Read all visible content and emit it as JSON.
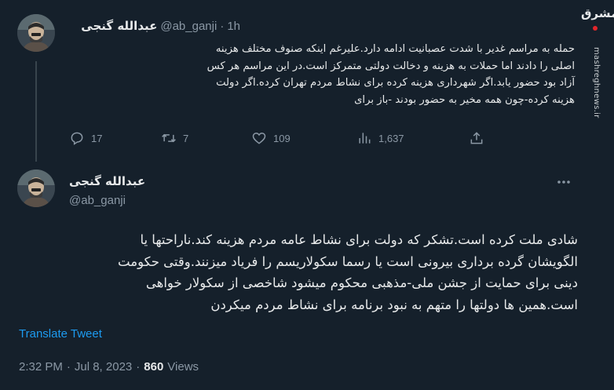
{
  "watermark": {
    "logo_text": "مشرق",
    "url": "mashreghnews.ir"
  },
  "tweet1": {
    "author_name": "عبدالله گنجی",
    "handle": "@ab_ganji",
    "separator": "·",
    "time": "1h",
    "text_lines": [
      "حمله به مراسم غدیر با شدت عصبانیت ادامه دارد.علیرغم اینکه صنوف مختلف هزینه",
      "اصلی را دادند اما حملات به هزینه و دخالت دولتی متمرکز است.در این مراسم هر کس",
      "آزاد بود حضور یابد.اگر شهرداری هزینه کرده برای نشاط مردم تهران کرده.اگر دولت",
      "هزینه کرده-چون همه مخیر به حضور بودند -باز برای"
    ],
    "replies": "17",
    "retweets": "7",
    "likes": "109",
    "views": "1,637",
    "icons": [
      "reply-icon",
      "retweet-icon",
      "like-icon",
      "views-icon",
      "share-icon",
      "more-icon"
    ]
  },
  "tweet2": {
    "author_name": "عبدالله گنجی",
    "handle": "@ab_ganji",
    "text_lines": [
      "شادی ملت کرده است.تشکر که دولت برای نشاط عامه مردم هزینه کند.ناراحتها یا",
      "الگویشان گرده برداری بیرونی است یا رسما سکولاریسم را فریاد میزنند.وقتی حکومت",
      "دینی برای حمایت از جشن ملی-مذهبی محکوم میشود شاخصی از سکولار خواهی",
      "است.همین ها دولتها را متهم به نبود برنامه برای نشاط مردم میکردن"
    ],
    "translate_label": "Translate Tweet",
    "time": "2:32 PM",
    "date": "Jul 8, 2023",
    "dot": "·",
    "views_count": "860",
    "views_label": "Views",
    "icons": [
      "more-icon"
    ]
  },
  "colors": {
    "background": "#15202b",
    "text_primary": "#e7e9ea",
    "text_secondary": "#8b98a5",
    "accent": "#1d9bf0",
    "divider": "#38444d"
  }
}
